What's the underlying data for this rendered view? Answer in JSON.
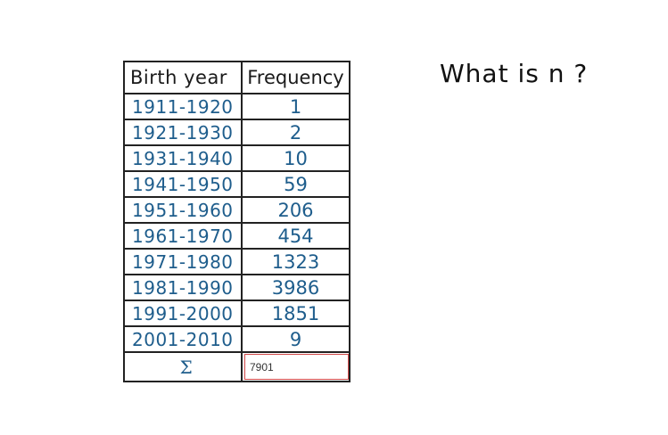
{
  "question": "What is n ?",
  "table": {
    "headers": {
      "year": "Birth year",
      "frequency": "Frequency"
    },
    "rows": [
      {
        "year": "1911-1920",
        "frequency": "1"
      },
      {
        "year": "1921-1930",
        "frequency": "2"
      },
      {
        "year": "1931-1940",
        "frequency": "10"
      },
      {
        "year": "1941-1950",
        "frequency": "59"
      },
      {
        "year": "1951-1960",
        "frequency": "206"
      },
      {
        "year": "1961-1970",
        "frequency": "454"
      },
      {
        "year": "1971-1980",
        "frequency": "1323"
      },
      {
        "year": "1981-1990",
        "frequency": "3986"
      },
      {
        "year": "1991-2000",
        "frequency": "1851"
      },
      {
        "year": "2001-2010",
        "frequency": "9"
      }
    ],
    "sum_symbol": "Σ",
    "answer_value": "7901"
  },
  "colors": {
    "ink_blue": "#1e5d8c",
    "ink_black": "#1a1a1a",
    "input_border": "#d24a4a"
  }
}
